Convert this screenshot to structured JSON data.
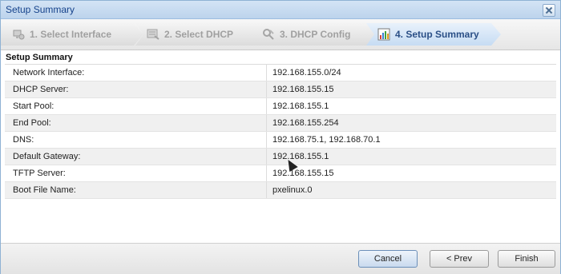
{
  "window": {
    "title": "Setup Summary"
  },
  "steps": [
    {
      "label": "1. Select Interface",
      "icon": "interface-icon"
    },
    {
      "label": "2. Select DHCP",
      "icon": "dhcp-list-icon"
    },
    {
      "label": "3. DHCP Config",
      "icon": "config-tools-icon"
    },
    {
      "label": "4. Setup Summary",
      "icon": "summary-chart-icon"
    }
  ],
  "summary": {
    "title": "Setup Summary",
    "rows": [
      {
        "key": "Network Interface:",
        "value": "192.168.155.0/24"
      },
      {
        "key": "DHCP Server:",
        "value": "192.168.155.15"
      },
      {
        "key": "Start Pool:",
        "value": "192.168.155.1"
      },
      {
        "key": "End Pool:",
        "value": "192.168.155.254"
      },
      {
        "key": "DNS:",
        "value": "192.168.75.1, 192.168.70.1"
      },
      {
        "key": "Default Gateway:",
        "value": "192.168.155.1"
      },
      {
        "key": "TFTP Server:",
        "value": "192.168.155.15"
      },
      {
        "key": "Boot File Name:",
        "value": "pxelinux.0"
      }
    ]
  },
  "buttons": {
    "cancel": "Cancel",
    "prev": "< Prev",
    "finish": "Finish"
  }
}
